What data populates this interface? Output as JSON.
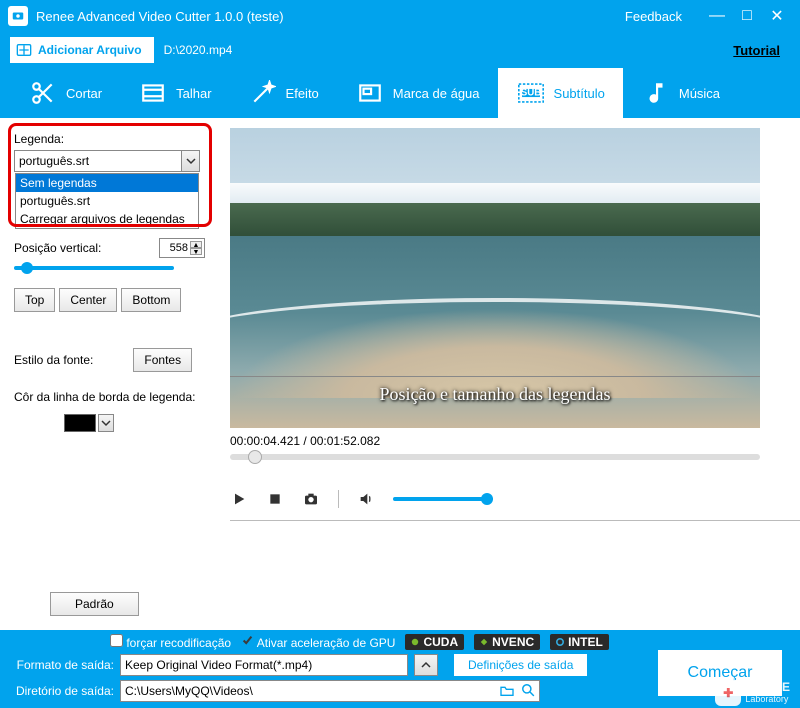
{
  "titlebar": {
    "title": "Renee Advanced Video Cutter 1.0.0 (teste)",
    "feedback": "Feedback"
  },
  "toolbar": {
    "add_file": "Adicionar Arquivo",
    "file_path": "D:\\2020.mp4",
    "tutorial": "Tutorial"
  },
  "tabs": {
    "cut": "Cortar",
    "trim": "Talhar",
    "effect": "Efeito",
    "watermark": "Marca de água",
    "subtitle": "Subtítulo",
    "music": "Música"
  },
  "subtitle": {
    "label": "Legenda:",
    "selected": "português.srt",
    "options": [
      "Sem legendas",
      "português.srt",
      "Carregar arquivos de legendas"
    ],
    "selected_index": 0,
    "vpos_label": "Posição vertical:",
    "vpos_value": "558",
    "btn_top": "Top",
    "btn_center": "Center",
    "btn_bottom": "Bottom",
    "font_style_label": "Estilo da fonte:",
    "fonts_btn": "Fontes",
    "border_color_label": "Côr da linha de borda de legenda:",
    "border_color": "#000000",
    "default_btn": "Padrão"
  },
  "preview": {
    "overlay_text": "Posição e tamanho das legendas",
    "timecode": "00:00:04.421 / 00:01:52.082"
  },
  "encode": {
    "force_reencode": "forçar recodificação",
    "gpu_accel": "Ativar aceleração de GPU",
    "badges": [
      "CUDA",
      "NVENC",
      "INTEL"
    ]
  },
  "output": {
    "format_label": "Formato de saída:",
    "format_value": "Keep Original Video Format(*.mp4)",
    "output_defs": "Definições de saída",
    "dir_label": "Diretório de saída:",
    "dir_value": "C:\\Users\\MyQQ\\Videos\\",
    "start_btn": "Começar"
  },
  "brand": {
    "name": "RENE.E",
    "sub": "Laboratory"
  }
}
